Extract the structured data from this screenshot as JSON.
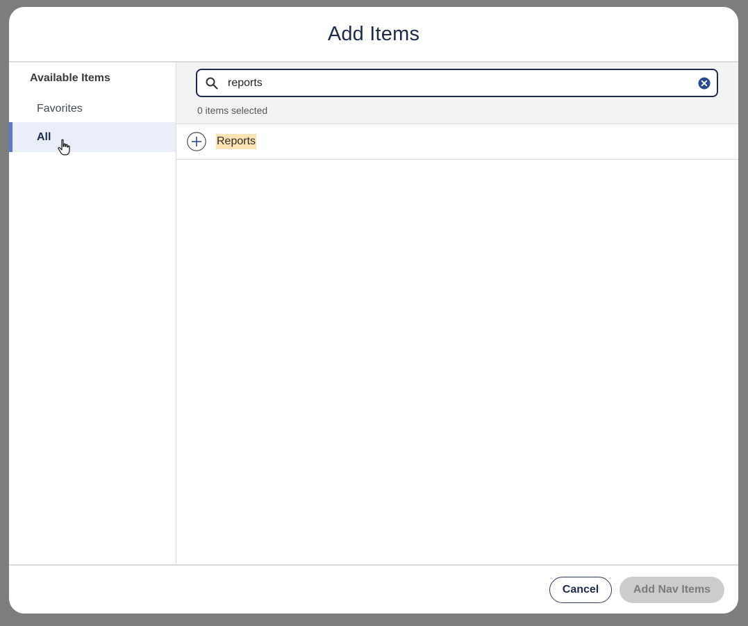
{
  "modal": {
    "title": "Add Items"
  },
  "sidebar": {
    "heading": "Available Items",
    "items": [
      {
        "label": "Favorites",
        "selected": false
      },
      {
        "label": "All",
        "selected": true
      }
    ]
  },
  "search": {
    "value": "reports",
    "icon": "search-icon",
    "clear_icon": "clear-circle-icon"
  },
  "selection": {
    "count_text": "0 items selected"
  },
  "results": [
    {
      "label": "Reports",
      "icon": "plus-circle-icon"
    }
  ],
  "footer": {
    "cancel_label": "Cancel",
    "add_label": "Add Nav Items"
  },
  "colors": {
    "accent": "#5b79c6",
    "navy": "#1d2a4a",
    "highlight": "#fde3b3",
    "disabled_bg": "#cccccc"
  }
}
